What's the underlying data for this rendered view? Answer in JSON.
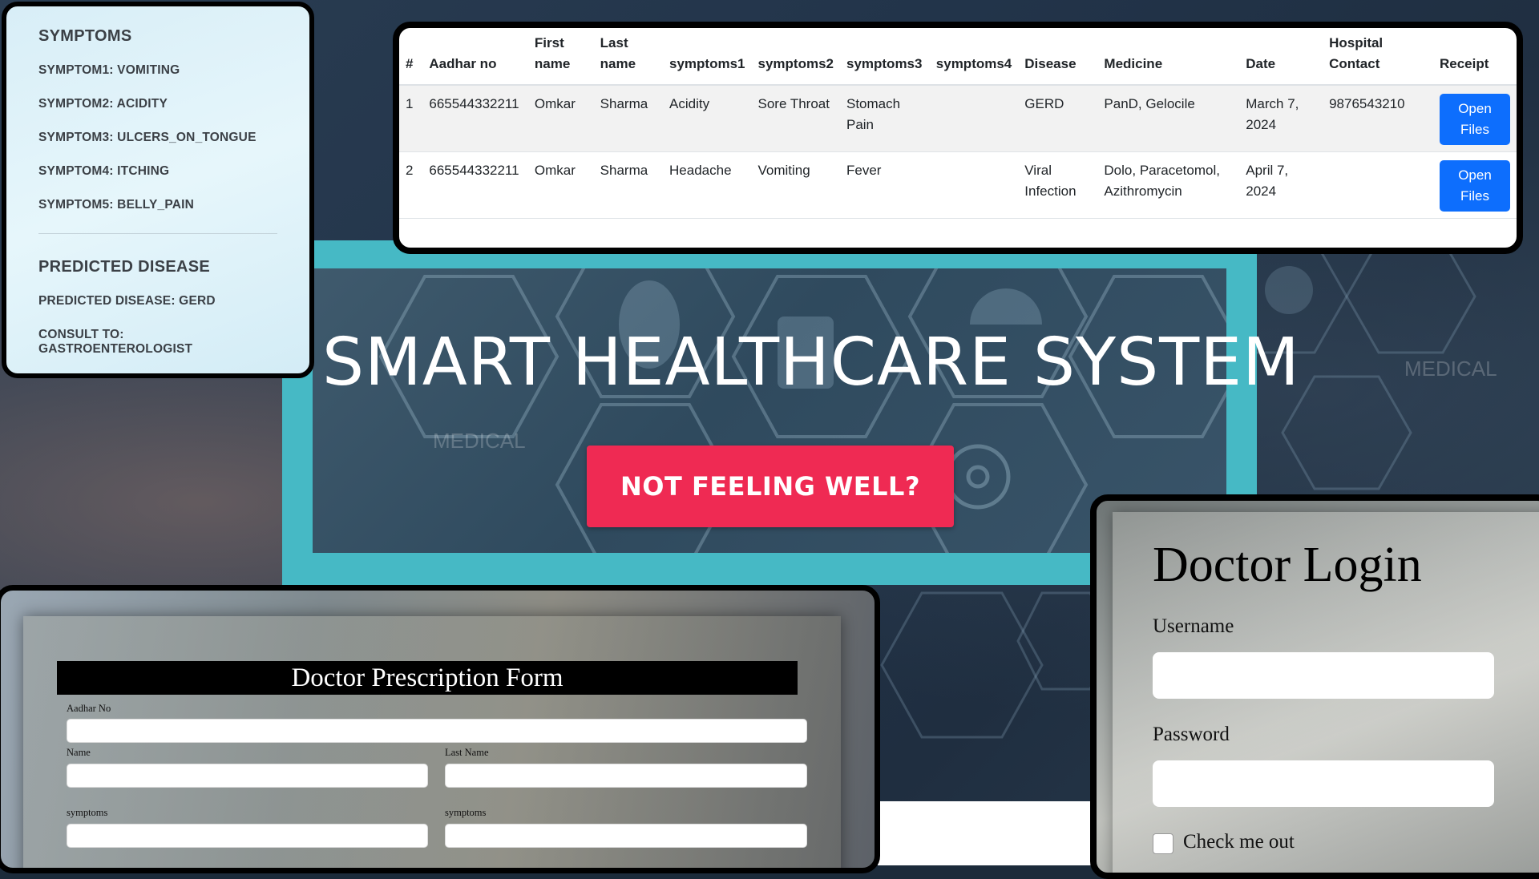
{
  "symptoms_panel": {
    "heading": "SYMPTOMS",
    "items": [
      "SYMPTOM1: VOMITING",
      "SYMPTOM2: ACIDITY",
      "SYMPTOM3: ULCERS_ON_TONGUE",
      "SYMPTOM4: ITCHING",
      "SYMPTOM5: BELLY_PAIN"
    ],
    "predicted_heading": "PREDICTED DISEASE",
    "predicted_disease": "PREDICTED DISEASE: GERD",
    "consult": "CONSULT TO: GASTROENTEROLOGIST"
  },
  "records_table": {
    "headers": [
      "#",
      "Aadhar no",
      "First name",
      "Last name",
      "symptoms1",
      "symptoms2",
      "symptoms3",
      "symptoms4",
      "Disease",
      "Medicine",
      "Date",
      "Hospital Contact",
      "Receipt"
    ],
    "rows": [
      {
        "num": "1",
        "aadhar": "665544332211",
        "first": "Omkar",
        "last": "Sharma",
        "s1": "Acidity",
        "s2": "Sore Throat",
        "s3": "Stomach Pain",
        "s4": "",
        "disease": "GERD",
        "medicine": "PanD, Gelocile",
        "date": "March 7, 2024",
        "contact": "9876543210",
        "receipt": "Open Files"
      },
      {
        "num": "2",
        "aadhar": "665544332211",
        "first": "Omkar",
        "last": "Sharma",
        "s1": "Headache",
        "s2": "Vomiting",
        "s3": "Fever",
        "s4": "",
        "disease": "Viral Infection",
        "medicine": "Dolo, Paracetomol, Azithromycin",
        "date": "April 7, 2024",
        "contact": "",
        "receipt": "Open Files"
      }
    ]
  },
  "hero": {
    "title": "SMART HEALTHCARE SYSTEM",
    "cta": "NOT FEELING WELL?",
    "watermark": "MEDICAL"
  },
  "prescription_form": {
    "title": "Doctor Prescription Form",
    "aadhar_label": "Aadhar No",
    "name_label": "Name",
    "last_name_label": "Last Name",
    "symptoms_label_1": "symptoms",
    "symptoms_label_2": "symptoms"
  },
  "login": {
    "title": "Doctor Login",
    "username_label": "Username",
    "password_label": "Password",
    "check_label": "Check me out"
  },
  "colors": {
    "accent_teal": "#46b9c5",
    "cta_red": "#ef2a53",
    "button_blue": "#0d6efd"
  }
}
